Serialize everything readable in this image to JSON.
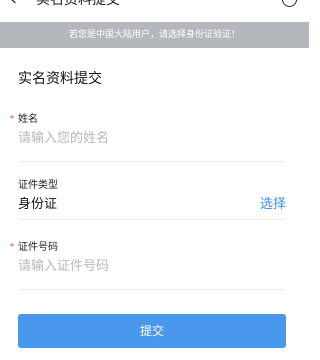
{
  "header": {
    "title": "实名资料提交",
    "back_icon": "back-arrow-icon",
    "help_icon": "help-icon"
  },
  "notice": "若您是中国大陆用户，请选择身份证验证！",
  "form": {
    "section_title": "实名资料提交",
    "name": {
      "required_mark": "*",
      "label": "姓名",
      "placeholder": "请输入您的姓名"
    },
    "id_type": {
      "label": "证件类型",
      "value": "身份证",
      "action": "选择"
    },
    "id_number": {
      "required_mark": "*",
      "label": "证件号码",
      "placeholder": "请输入证件号码"
    },
    "submit_label": "提交"
  },
  "colors": {
    "accent": "#4a98ee",
    "link": "#3f8fe0",
    "notice_bg": "#b4b7bb",
    "required": "#e53935"
  }
}
